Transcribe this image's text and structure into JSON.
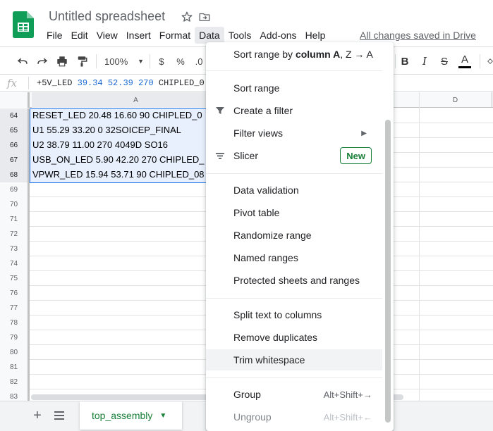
{
  "header": {
    "doc_title": "Untitled spreadsheet",
    "saved_status": "All changes saved in Drive",
    "brand_color": "#0f9d58"
  },
  "menubar": [
    "File",
    "Edit",
    "View",
    "Insert",
    "Format",
    "Data",
    "Tools",
    "Add-ons",
    "Help"
  ],
  "toolbar": {
    "zoom": "100%",
    "currency": "$",
    "percent": "%",
    "decimal": ".0",
    "bold": "B",
    "italic": "I",
    "strike": "S",
    "text_color": "A"
  },
  "formula_bar": {
    "fx": "fx",
    "name": "+5V_LED",
    "x": "39.34",
    "y": "52.39",
    "rot": "270",
    "pkg": "CHIPLED_0"
  },
  "columns": [
    "A",
    "D"
  ],
  "rows": [
    {
      "num": "64",
      "value": "RESET_LED 20.48 16.60  90  CHIPLED_0",
      "selected": true
    },
    {
      "num": "65",
      "value": "U1 55.29 33.20   0  32SOICEP_FINAL",
      "selected": true
    },
    {
      "num": "66",
      "value": "U2 38.79 11.00 270 4049D SO16",
      "selected": true
    },
    {
      "num": "67",
      "value": "USB_ON_LED  5.90 42.20 270  CHIPLED_",
      "selected": true
    },
    {
      "num": "68",
      "value": "VPWR_LED 15.94 53.71  90  CHIPLED_08",
      "selected": true
    },
    {
      "num": "69",
      "value": "",
      "selected": false
    },
    {
      "num": "70",
      "value": "",
      "selected": false
    },
    {
      "num": "71",
      "value": "",
      "selected": false
    },
    {
      "num": "72",
      "value": "",
      "selected": false
    },
    {
      "num": "73",
      "value": "",
      "selected": false
    },
    {
      "num": "74",
      "value": "",
      "selected": false
    },
    {
      "num": "75",
      "value": "",
      "selected": false
    },
    {
      "num": "76",
      "value": "",
      "selected": false
    },
    {
      "num": "77",
      "value": "",
      "selected": false
    },
    {
      "num": "78",
      "value": "",
      "selected": false
    },
    {
      "num": "79",
      "value": "",
      "selected": false
    },
    {
      "num": "80",
      "value": "",
      "selected": false
    },
    {
      "num": "81",
      "value": "",
      "selected": false
    },
    {
      "num": "82",
      "value": "",
      "selected": false
    },
    {
      "num": "83",
      "value": "",
      "selected": false
    }
  ],
  "data_menu": {
    "sort_by_column_prefix": "Sort range by ",
    "sort_by_column_bold": "column A",
    "sort_by_column_suffix": ", Z → A",
    "sort_range": "Sort range",
    "create_filter": "Create a filter",
    "filter_views": "Filter views",
    "slicer": "Slicer",
    "slicer_badge": "New",
    "data_validation": "Data validation",
    "pivot_table": "Pivot table",
    "randomize_range": "Randomize range",
    "named_ranges": "Named ranges",
    "protected_sheets": "Protected sheets and ranges",
    "split_text": "Split text to columns",
    "remove_duplicates": "Remove duplicates",
    "trim_whitespace": "Trim whitespace",
    "group": "Group",
    "group_shortcut": "Alt+Shift+→",
    "ungroup": "Ungroup",
    "ungroup_shortcut": "Alt+Shift+←"
  },
  "sheet_tab": {
    "name": "top_assembly"
  },
  "icons": [
    "sheets-logo-icon",
    "star-icon",
    "move-folder-icon",
    "undo-icon",
    "redo-icon",
    "print-icon",
    "paint-format-icon",
    "filter-icon",
    "slicer-icon",
    "add-sheet-icon",
    "all-sheets-icon"
  ]
}
